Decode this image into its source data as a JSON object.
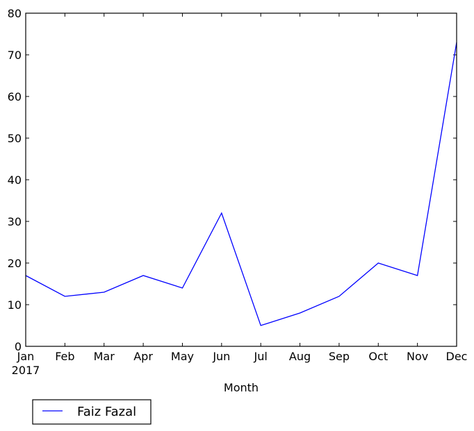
{
  "chart_data": {
    "type": "line",
    "title": "",
    "xlabel": "Month",
    "ylabel": "",
    "categories": [
      "Jan",
      "Feb",
      "Mar",
      "Apr",
      "May",
      "Jun",
      "Jul",
      "Aug",
      "Sep",
      "Oct",
      "Nov",
      "Dec"
    ],
    "x_sublabel": "2017",
    "ylim": [
      0,
      80
    ],
    "yticks": [
      0,
      10,
      20,
      30,
      40,
      50,
      60,
      70,
      80
    ],
    "grid": false,
    "series": [
      {
        "name": "Faiz Fazal",
        "color": "#0000ff",
        "values": [
          17,
          12,
          13,
          17,
          14,
          32,
          5,
          8,
          12,
          20,
          17,
          73
        ]
      }
    ],
    "legend": {
      "placement": "bottom-left-outside",
      "entries": [
        "Faiz Fazal"
      ]
    }
  }
}
